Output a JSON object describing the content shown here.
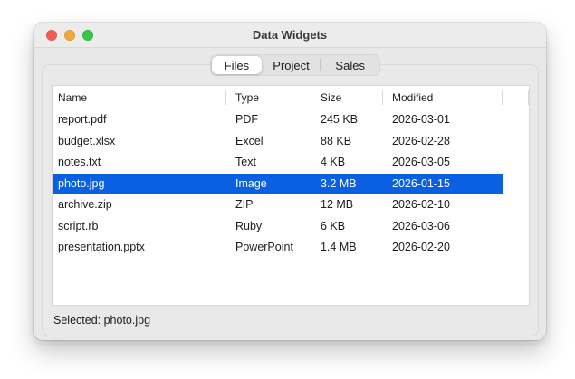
{
  "window": {
    "title": "Data Widgets",
    "traffic_lights": [
      "close",
      "minimize",
      "zoom"
    ]
  },
  "tabs": {
    "items": [
      {
        "label": "Files",
        "selected": true
      },
      {
        "label": "Project",
        "selected": false
      },
      {
        "label": "Sales",
        "selected": false
      }
    ]
  },
  "table": {
    "columns": [
      "Name",
      "Type",
      "Size",
      "Modified"
    ],
    "rows": [
      [
        "report.pdf",
        "PDF",
        "245 KB",
        "2026-03-01"
      ],
      [
        "budget.xlsx",
        "Excel",
        "88 KB",
        "2026-02-28"
      ],
      [
        "notes.txt",
        "Text",
        "4 KB",
        "2026-03-05"
      ],
      [
        "photo.jpg",
        "Image",
        "3.2 MB",
        "2026-01-15"
      ],
      [
        "archive.zip",
        "ZIP",
        "12 MB",
        "2026-02-10"
      ],
      [
        "script.rb",
        "Ruby",
        "6 KB",
        "2026-03-06"
      ],
      [
        "presentation.pptx",
        "PowerPoint",
        "1.4 MB",
        "2026-02-20"
      ]
    ],
    "selected_index": 3
  },
  "status": {
    "text": "Selected: photo.jpg"
  },
  "colors": {
    "selection": "#0a60e0",
    "close_button": "#f45c51",
    "minimize_button": "#f3a83c",
    "zoom_button": "#34c648",
    "titlebar_bg": "#ececec",
    "window_bg": "#e8e8e8"
  }
}
